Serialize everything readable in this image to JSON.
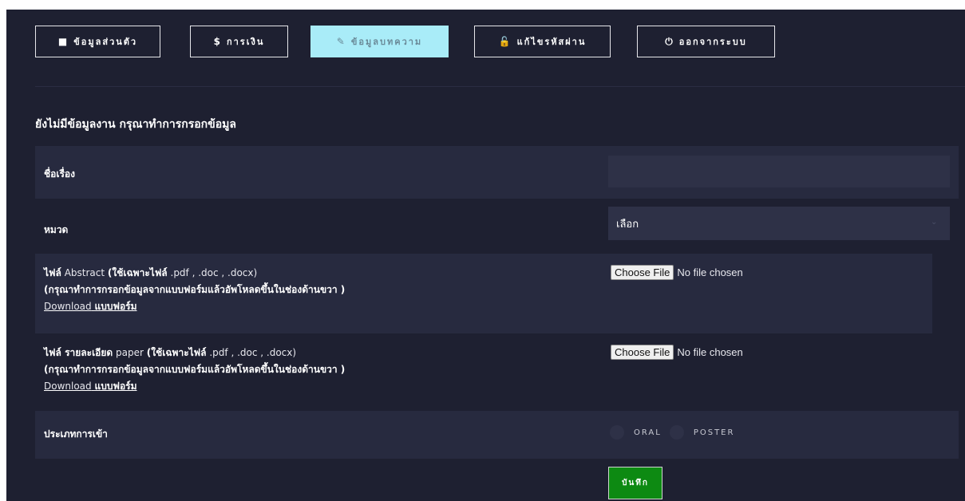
{
  "nav": {
    "items": [
      {
        "icon": "■",
        "label": "ข้อมูลส่วนตัว"
      },
      {
        "icon": "$",
        "label": "การเงิน"
      },
      {
        "icon": "✎",
        "label": "ข้อมูลบทความ"
      },
      {
        "icon": "🔓",
        "label": "แก้ไขรหัสผ่าน"
      },
      {
        "icon": "⏻",
        "label": "ออกจากระบบ"
      }
    ],
    "active_index": 2
  },
  "form": {
    "notice": "ยังไม่มีข้อมูลงาน กรุณาทำการกรอกข้อมูล",
    "title_label": "ชื่อเรื่อง",
    "title_value": "",
    "category_label": "หมวด",
    "category_selected": "เลือก",
    "abstract": {
      "prefix": "ไฟล์",
      "name": "Abstract",
      "note_open": "(ใช้เฉพาะไฟล์",
      "ext": ".pdf , .doc , .docx)",
      "hint": "(กรุณาทำการกรอกข้อมูลจากแบบฟอร์มแล้วอัพโหลดขึ้นในช่องด้านขวา )",
      "download": "Download",
      "form_word": "แบบฟอร์ม"
    },
    "paper": {
      "prefix": "ไฟล์ รายละเอียด",
      "name": "paper",
      "note_open": "(ใช้เฉพาะไฟล์",
      "ext": ".pdf , .doc , .docx)",
      "hint": "(กรุณาทำการกรอกข้อมูลจากแบบฟอร์มแล้วอัพโหลดขึ้นในช่องด้านขวา )",
      "download": "Download",
      "form_word": "แบบฟอร์ม"
    },
    "file_button": "Choose File",
    "file_status": "No file chosen",
    "presentation_label": "ประเภทการเข้า",
    "options": [
      "ORAL",
      "POSTER"
    ],
    "save": "บันทึก"
  },
  "colors": {
    "background": "#1e2031",
    "row_shade": "#272a3f",
    "active_tab": "#a9ecf8",
    "save": "#0d8a12"
  }
}
